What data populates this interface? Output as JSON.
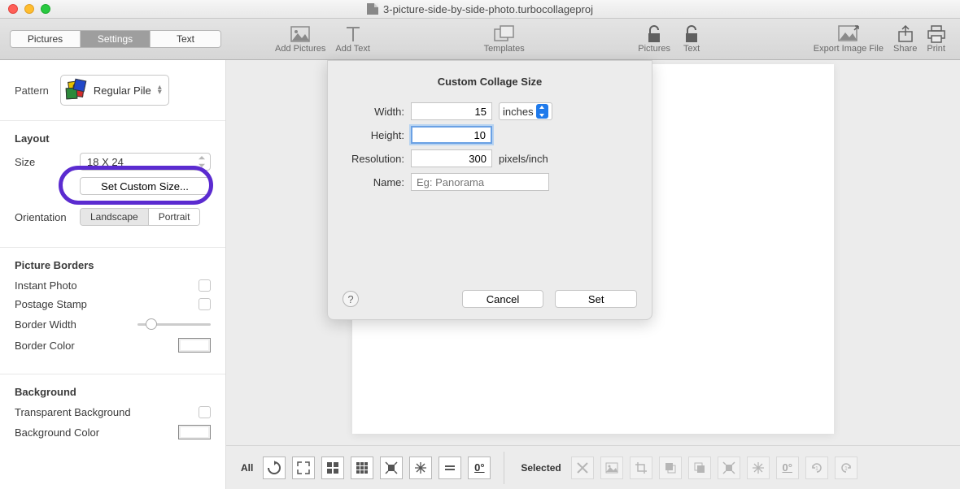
{
  "window": {
    "title": "3-picture-side-by-side-photo.turbocollageproj"
  },
  "tabs": {
    "pictures": "Pictures",
    "settings": "Settings",
    "text": "Text",
    "active": "Settings"
  },
  "toolbar": {
    "addPictures": "Add Pictures",
    "addText": "Add Text",
    "templates": "Templates",
    "lockPictures": "Pictures",
    "lockText": "Text",
    "export": "Export Image File",
    "share": "Share",
    "print": "Print"
  },
  "sidebar": {
    "patternLabel": "Pattern",
    "patternValue": "Regular Pile",
    "layoutHeader": "Layout",
    "sizeLabel": "Size",
    "sizeValue": "18 X 24",
    "setCustom": "Set Custom Size...",
    "orientationLabel": "Orientation",
    "landscape": "Landscape",
    "portrait": "Portrait",
    "bordersHeader": "Picture Borders",
    "instantPhoto": "Instant Photo",
    "postageStamp": "Postage Stamp",
    "borderWidth": "Border Width",
    "borderColor": "Border Color",
    "backgroundHeader": "Background",
    "transparentBg": "Transparent Background",
    "bgColor": "Background Color"
  },
  "modal": {
    "title": "Custom Collage Size",
    "widthLabel": "Width:",
    "widthValue": "15",
    "heightLabel": "Height:",
    "heightValue": "10",
    "unit": "inches",
    "resLabel": "Resolution:",
    "resValue": "300",
    "resUnit": "pixels/inch",
    "nameLabel": "Name:",
    "namePlaceholder": "Eg: Panorama",
    "help": "?",
    "cancel": "Cancel",
    "set": "Set"
  },
  "bottombar": {
    "all": "All",
    "selected": "Selected",
    "zero": "0°"
  }
}
